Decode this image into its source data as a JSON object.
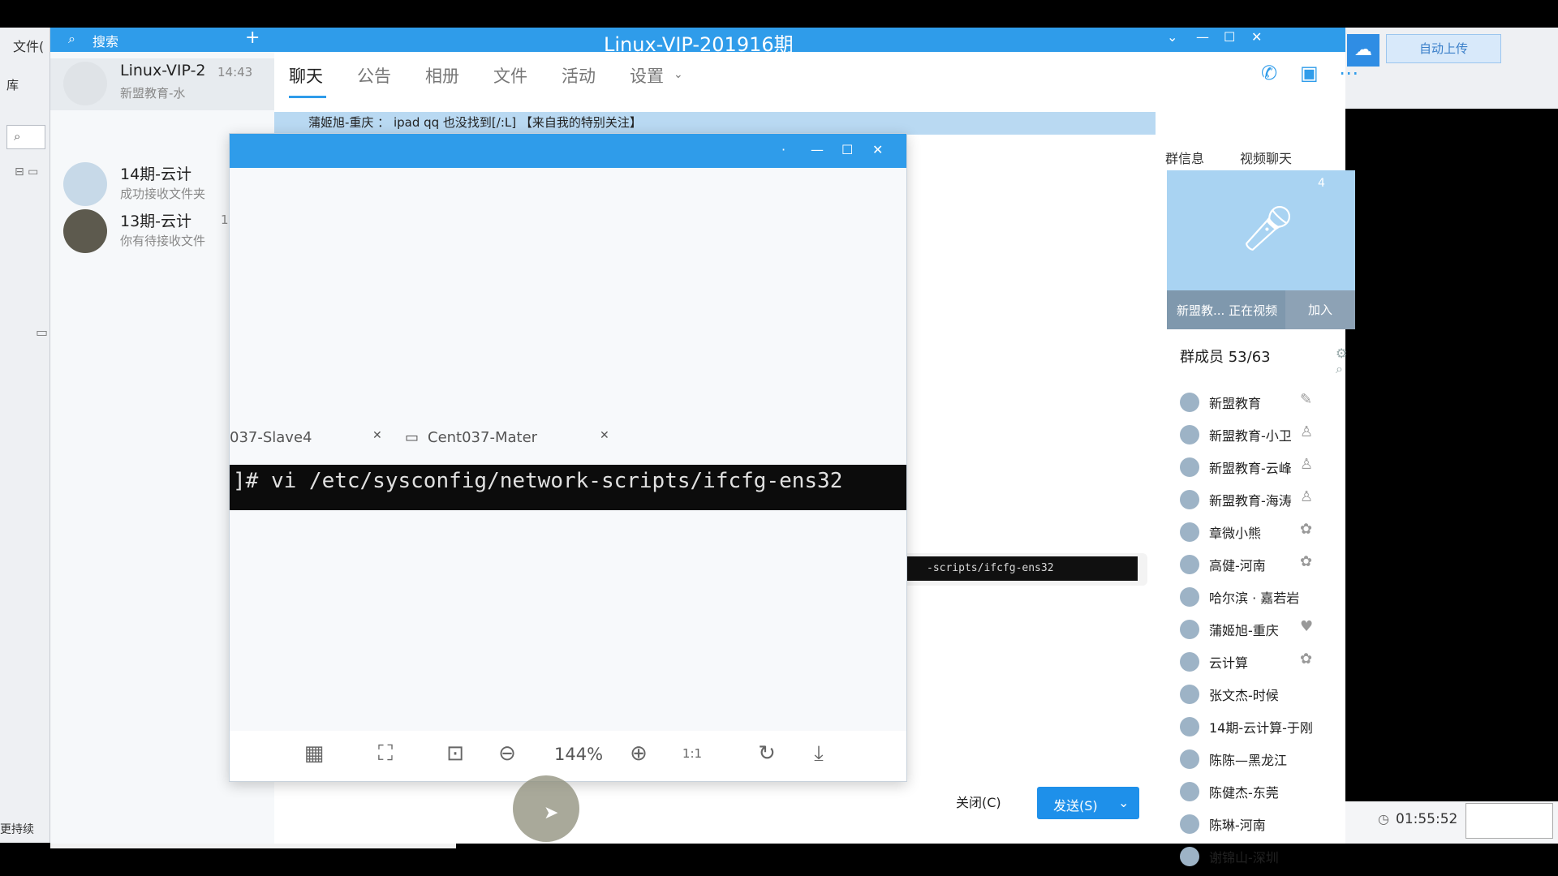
{
  "background_left": {
    "menu_file": "文件(",
    "lib_label": "库",
    "search_icon": "search-icon",
    "status_text": "更持续"
  },
  "background_right": {
    "cloud_icon": "cloud-icon",
    "sync_button": "自动上传"
  },
  "clock": {
    "time": "01:55:52"
  },
  "qq": {
    "search_placeholder": "搜索",
    "window_title": "Linux-VIP-201916期",
    "conversations": [
      {
        "name": "Linux-VIP-2",
        "time": "14:43",
        "subtitle": "新盟教育-水",
        "active": true
      },
      {
        "name": "14期-云计",
        "time": "",
        "subtitle": "成功接收文件夹",
        "active": false
      },
      {
        "name": "13期-云计",
        "time": "1",
        "subtitle": "你有待接收文件",
        "active": false
      }
    ],
    "tabs": [
      {
        "label": "聊天",
        "active": true
      },
      {
        "label": "公告"
      },
      {
        "label": "相册"
      },
      {
        "label": "文件"
      },
      {
        "label": "活动"
      },
      {
        "label": "设置"
      }
    ],
    "announcement": "蒲姬旭-重庆 ： ipad qq 也没找到[/:L] 【来自我的特别关注】",
    "right_tabs": [
      "群信息",
      "视频聊天"
    ],
    "video": {
      "count": "4",
      "status": "新盟教... 正在视频",
      "join": "加入"
    },
    "members_title": "群成员 53/63",
    "members": [
      "新盟教育",
      "新盟教育-小卫",
      "新盟教育-云峰",
      "新盟教育-海涛",
      "章微小熊",
      "高健-河南",
      "哈尔滨 · 嘉若岩",
      "蒲姬旭-重庆",
      "云计算",
      "张文杰-时候",
      "14期-云计算-于刚",
      "陈陈—黑龙江",
      "陈健杰-东莞",
      "陈琳-河南",
      "谢锦山-深圳"
    ],
    "chat_snippet": "-scripts/ifcfg-ens32",
    "close_label": "关闭(C)",
    "send_label": "发送(S)"
  },
  "viewer": {
    "tab_left": "037-Slave4",
    "tab_right": "Cent037-Mater",
    "command": "]# vi /etc/sysconfig/network-scripts/ifcfg-ens32",
    "zoom": "144%",
    "toolbar_icons": [
      "thumbnail-icon",
      "crop-icon",
      "fit-screen-icon",
      "zoom-out-icon",
      "zoom-in-icon",
      "actual-size-icon",
      "rotate-icon",
      "download-icon"
    ],
    "actual_size_label": "1:1"
  },
  "colors": {
    "titlebar": "#2f9cea",
    "send_button": "#1e90ea",
    "announcement": "#b9d9f2"
  }
}
